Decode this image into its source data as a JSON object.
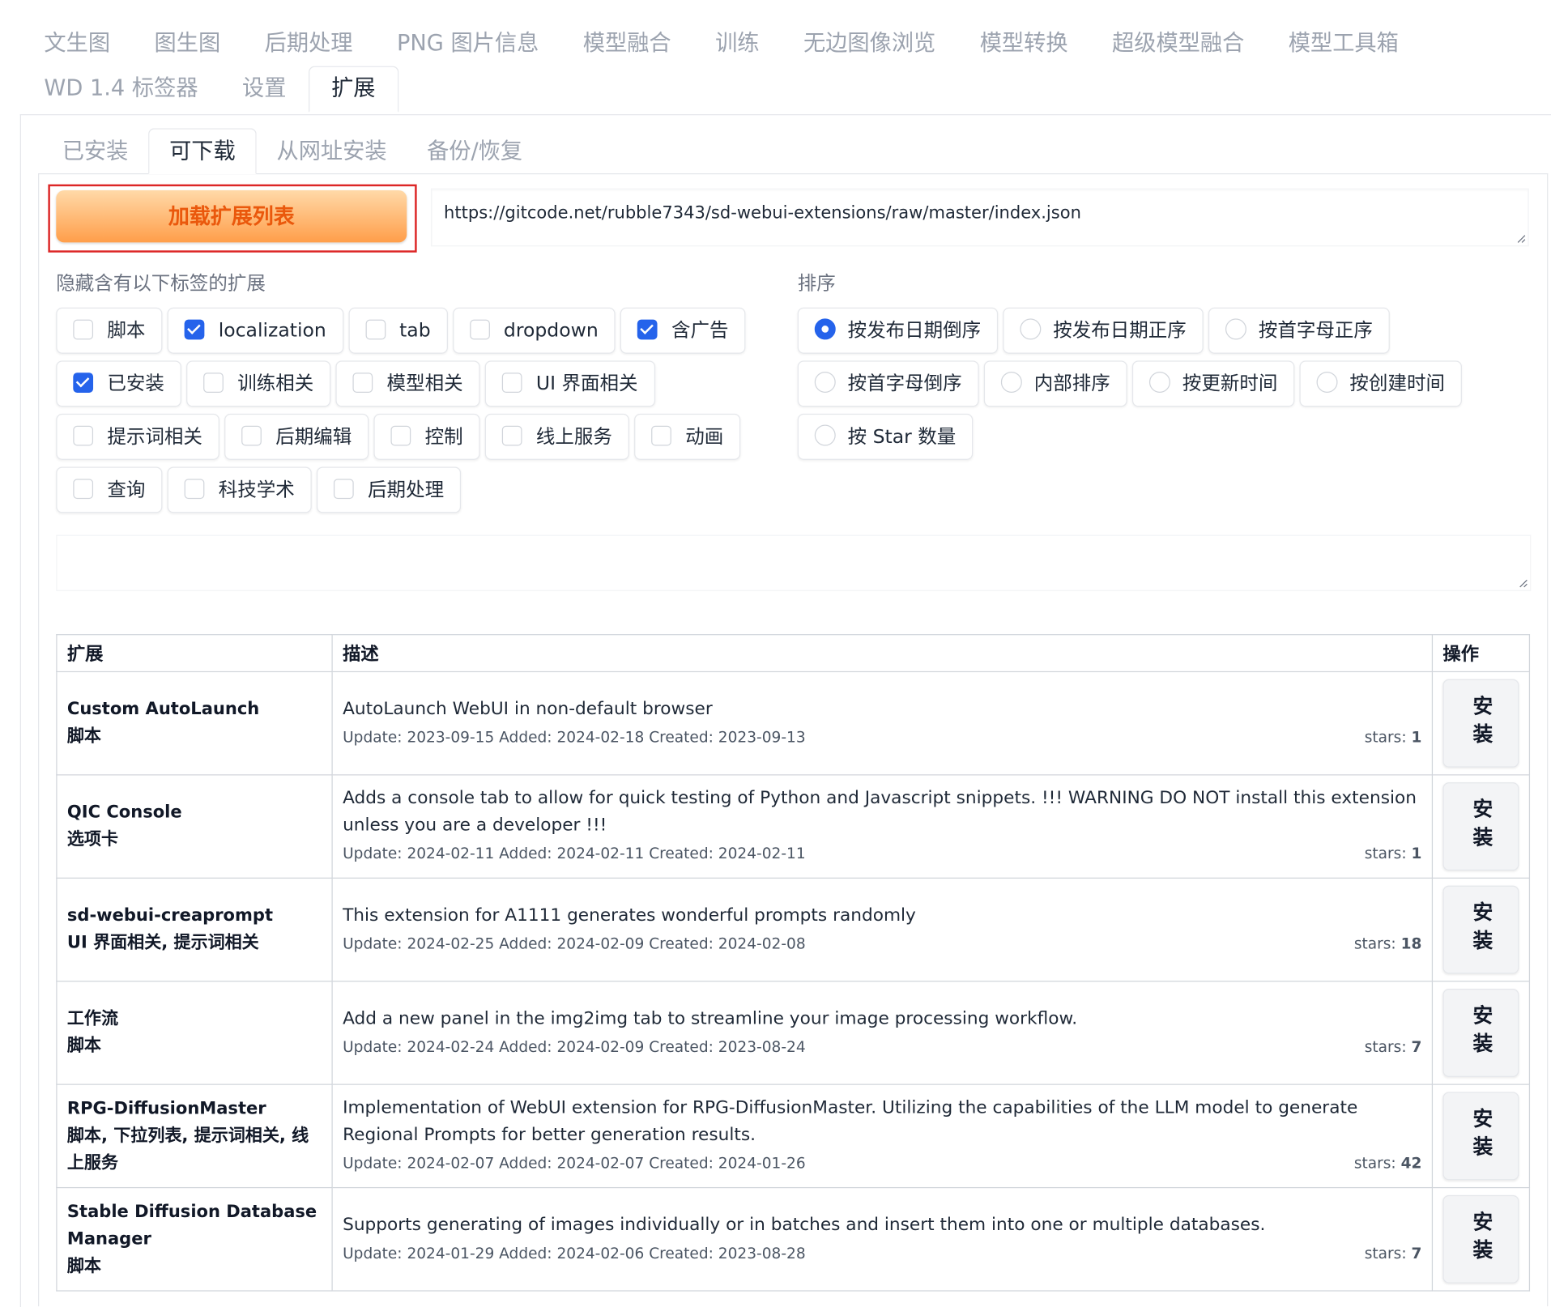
{
  "top_tabs": {
    "row1": [
      "文生图",
      "图生图",
      "后期处理",
      "PNG 图片信息",
      "模型融合",
      "训练",
      "无边图像浏览",
      "模型转换",
      "超级模型融合",
      "模型工具箱"
    ],
    "row2": [
      "WD 1.4 标签器",
      "设置",
      "扩展"
    ],
    "active": "扩展"
  },
  "sub_tabs": {
    "items": [
      "已安装",
      "可下载",
      "从网址安装",
      "备份/恢复"
    ],
    "active": "可下载"
  },
  "load_button": {
    "label": "加载扩展列表"
  },
  "url_field": {
    "value": "https://gitcode.net/rubble7343/sd-webui-extensions/raw/master/index.json"
  },
  "hide_tags": {
    "label": "隐藏含有以下标签的扩展",
    "rows": [
      [
        {
          "label": "脚本",
          "checked": false
        },
        {
          "label": "localization",
          "checked": true
        },
        {
          "label": "tab",
          "checked": false
        },
        {
          "label": "dropdown",
          "checked": false
        },
        {
          "label": "含广告",
          "checked": true
        }
      ],
      [
        {
          "label": "已安装",
          "checked": true
        },
        {
          "label": "训练相关",
          "checked": false
        },
        {
          "label": "模型相关",
          "checked": false
        },
        {
          "label": "UI 界面相关",
          "checked": false
        }
      ],
      [
        {
          "label": "提示词相关",
          "checked": false
        },
        {
          "label": "后期编辑",
          "checked": false
        },
        {
          "label": "控制",
          "checked": false
        },
        {
          "label": "线上服务",
          "checked": false
        },
        {
          "label": "动画",
          "checked": false
        }
      ],
      [
        {
          "label": "查询",
          "checked": false
        },
        {
          "label": "科技学术",
          "checked": false
        },
        {
          "label": "后期处理",
          "checked": false
        }
      ]
    ]
  },
  "sort": {
    "label": "排序",
    "rows": [
      [
        {
          "label": "按发布日期倒序",
          "selected": true
        },
        {
          "label": "按发布日期正序",
          "selected": false
        },
        {
          "label": "按首字母正序",
          "selected": false
        }
      ],
      [
        {
          "label": "按首字母倒序",
          "selected": false
        },
        {
          "label": "内部排序",
          "selected": false
        },
        {
          "label": "按更新时间",
          "selected": false
        },
        {
          "label": "按创建时间",
          "selected": false
        }
      ],
      [
        {
          "label": "按 Star 数量",
          "selected": false
        }
      ]
    ]
  },
  "table": {
    "headers": [
      "扩展",
      "描述",
      "操作"
    ],
    "rows": [
      {
        "name": "Custom AutoLaunch",
        "tags": "脚本",
        "description": "AutoLaunch WebUI in non-default browser",
        "meta": "Update: 2023-09-15 Added: 2024-02-18 Created: 2023-09-13",
        "stars_label": "stars:",
        "stars": "1",
        "action": "安装"
      },
      {
        "name": "QIC Console",
        "tags": "选项卡",
        "description": "Adds a console tab to allow for quick testing of Python and Javascript snippets. !!! WARNING DO NOT install this extension unless you are a developer !!!",
        "meta": "Update: 2024-02-11 Added: 2024-02-11 Created: 2024-02-11",
        "stars_label": "stars:",
        "stars": "1",
        "action": "安装"
      },
      {
        "name": "sd-webui-creaprompt",
        "tags": "UI 界面相关, 提示词相关",
        "description": "This extension for A1111 generates wonderful prompts randomly",
        "meta": "Update: 2024-02-25 Added: 2024-02-09 Created: 2024-02-08",
        "stars_label": "stars:",
        "stars": "18",
        "action": "安装"
      },
      {
        "name": "工作流",
        "tags": "脚本",
        "description": "Add a new panel in the img2img tab to streamline your image processing workflow.",
        "meta": "Update: 2024-02-24 Added: 2024-02-09 Created: 2023-08-24",
        "stars_label": "stars:",
        "stars": "7",
        "action": "安装"
      },
      {
        "name": "RPG-DiffusionMaster",
        "tags": "脚本, 下拉列表, 提示词相关, 线上服务",
        "description": "Implementation of WebUI extension for RPG-DiffusionMaster. Utilizing the capabilities of the LLM model to generate Regional Prompts for better generation results.",
        "meta": "Update: 2024-02-07 Added: 2024-02-07 Created: 2024-01-26",
        "stars_label": "stars:",
        "stars": "42",
        "action": "安装"
      },
      {
        "name": "Stable Diffusion Database Manager",
        "tags": "脚本",
        "description": "Supports generating of images individually or in batches and insert them into one or multiple databases.",
        "meta": "Update: 2024-01-29 Added: 2024-02-06 Created: 2023-08-28",
        "stars_label": "stars:",
        "stars": "7",
        "action": "安装"
      }
    ]
  },
  "colors": {
    "accent": "#2563eb",
    "load_button_text": "#ea580c",
    "highlight_frame": "#dc2626"
  }
}
